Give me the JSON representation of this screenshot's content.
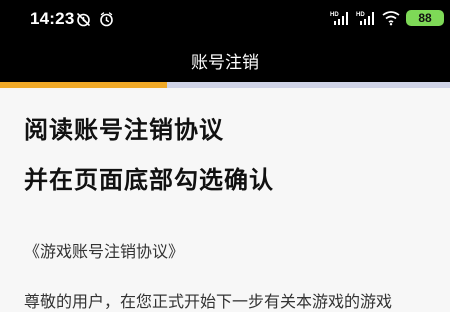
{
  "status_bar": {
    "time": "14:23",
    "battery": "88",
    "left_icons": [
      "alarm-muted-icon",
      "alarm-clock-icon"
    ],
    "right_icons": [
      "hd-signal-icon",
      "hd-signal-icon",
      "wifi-icon",
      "battery-icon"
    ]
  },
  "header": {
    "title": "账号注销"
  },
  "progress": {
    "fraction": 0.37,
    "fill_color": "#f0a928",
    "track_color": "#cfd3e6"
  },
  "content": {
    "heading_line_1": "阅读账号注销协议",
    "heading_line_2": "并在页面底部勾选确认",
    "agreement_title": "《游戏账号注销协议》",
    "body_text": "尊敬的用户，在您正式开始下一步有关本游戏的游戏"
  }
}
